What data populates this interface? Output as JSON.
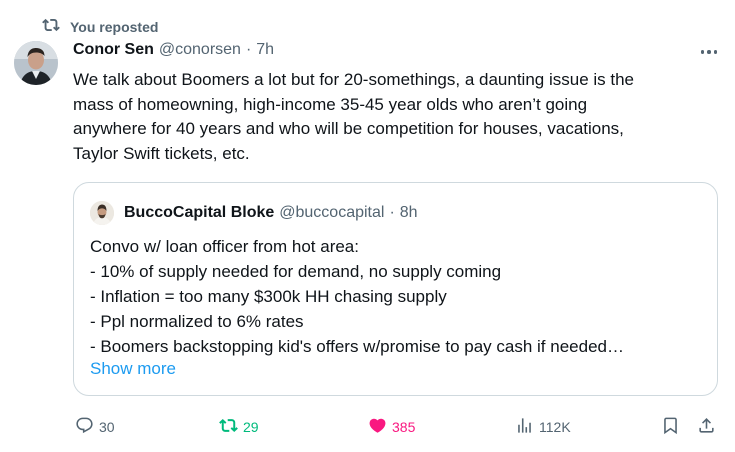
{
  "repost": {
    "label": "You reposted",
    "icon": "repost-icon"
  },
  "tweet": {
    "author_name": "Conor Sen",
    "handle": "@conorsen",
    "separator": "·",
    "time": "7h",
    "text": "We talk about Boomers a lot but for 20-somethings, a daunting issue is the\nmass of homeowning, high-income 35-45 year olds who aren’t going\nanywhere for 40 years and who will be competition for houses, vacations,\nTaylor Swift tickets, etc."
  },
  "quote": {
    "author_name": "BuccoCapital Bloke",
    "handle": "@buccocapital",
    "separator": "·",
    "time": "8h",
    "text": "Convo w/ loan officer from hot area:\n- 10% of supply needed for demand, no supply coming\n- Inflation = too many $300k HH chasing supply\n- Ppl normalized to 6% rates\n- Boomers backstopping kid's offers w/promise to pay cash if needed…",
    "show_more": "Show more"
  },
  "actions": {
    "replies": "30",
    "reposts": "29",
    "likes": "385",
    "views": "112K"
  },
  "colors": {
    "text": "#0f1419",
    "secondary": "#536471",
    "link": "#1d9bf0",
    "repost_active": "#00ba7c",
    "like_active": "#f91880",
    "border": "#cfd9de"
  }
}
